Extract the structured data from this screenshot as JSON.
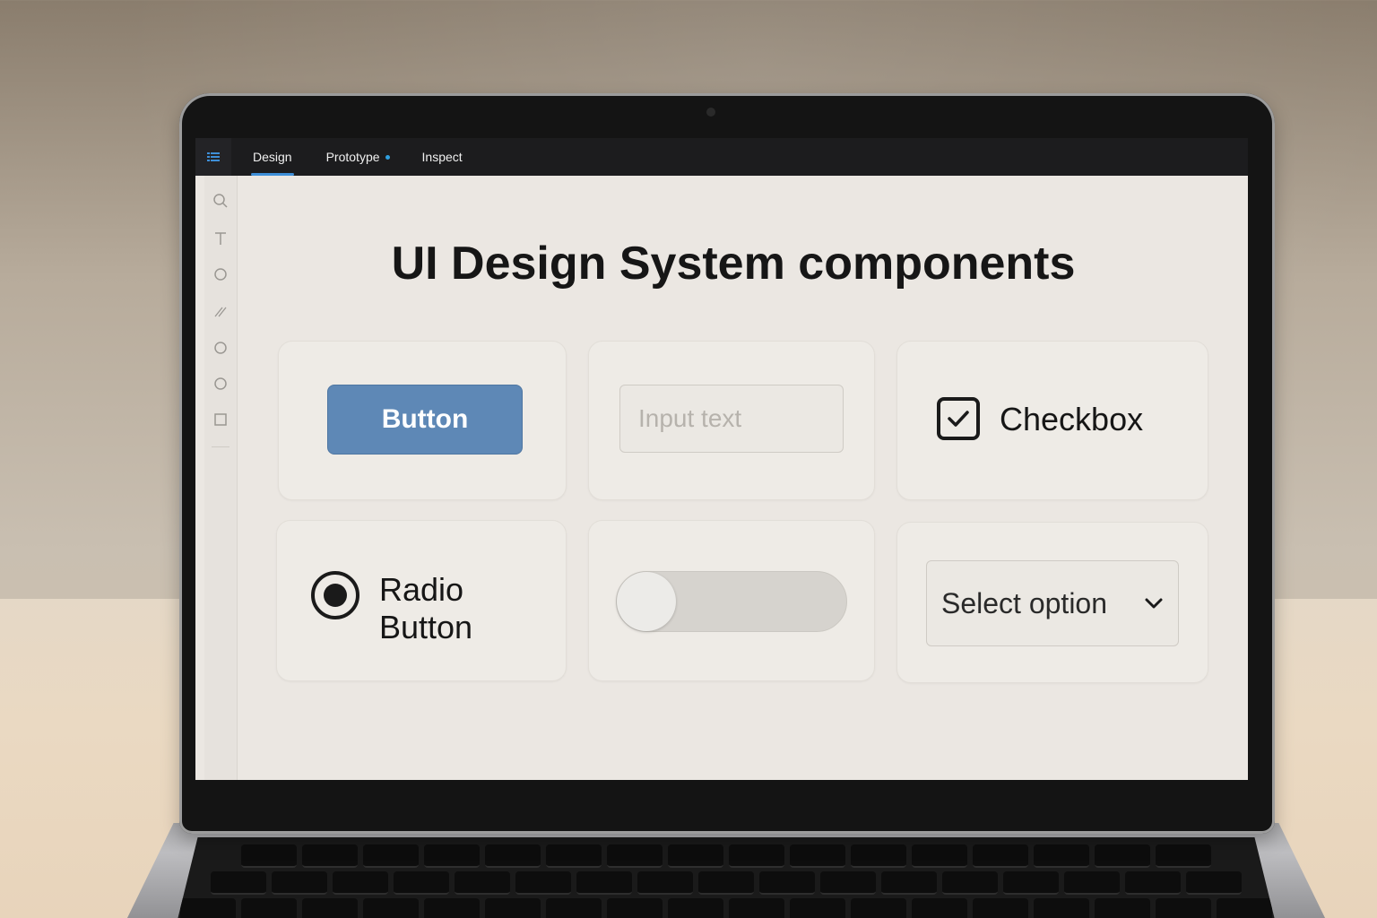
{
  "topbar": {
    "menu_icon": "list-icon",
    "tabs": [
      {
        "label": "Design",
        "active": true
      },
      {
        "label": "Prototype",
        "active": false,
        "dot": true
      },
      {
        "label": "Inspect",
        "active": false
      }
    ],
    "accent": "#3e8fd8"
  },
  "toolbar": {
    "tools": [
      "search-icon",
      "text-icon",
      "ellipse-icon",
      "line-icon",
      "ellipse-icon",
      "ellipse-icon",
      "rectangle-icon"
    ]
  },
  "canvas": {
    "title": "UI Design System components",
    "components": {
      "button": {
        "label": "Button",
        "color": "#5e88b6"
      },
      "input": {
        "placeholder": "Input text"
      },
      "checkbox": {
        "label": "Checkbox",
        "checked": true
      },
      "radio": {
        "label_line1": "Radio",
        "label_line2": "Button",
        "selected": true
      },
      "toggle": {
        "on": false
      },
      "select": {
        "value": "Select option",
        "icon": "chevron-down-icon"
      }
    }
  }
}
